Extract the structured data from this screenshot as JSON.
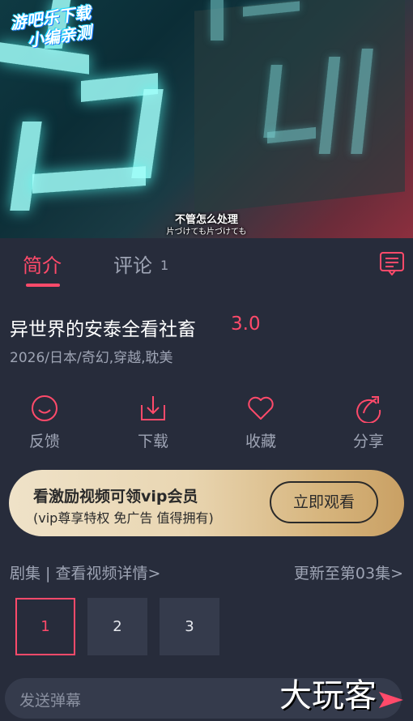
{
  "video": {
    "watermark_line1": "游吧乐下载",
    "watermark_line2": "小编亲测",
    "subtitle_main": "不管怎么处理",
    "subtitle_sub": "片づけても片づけても"
  },
  "tabs": {
    "intro_label": "简介",
    "comment_label": "评论",
    "comment_count": "1"
  },
  "show": {
    "title": "异世界的安泰全看社畜",
    "score": "3.0",
    "meta": "2026/日本/奇幻,穿越,耽美"
  },
  "actions": [
    {
      "label": "反馈",
      "icon": "feedback-smile-icon"
    },
    {
      "label": "下载",
      "icon": "download-icon"
    },
    {
      "label": "收藏",
      "icon": "heart-icon"
    },
    {
      "label": "分享",
      "icon": "share-icon"
    }
  ],
  "vip_banner": {
    "title": "看激励视频可领vip会员",
    "subtitle": "(vip尊享特权 免广告 值得拥有)",
    "button": "立即观看"
  },
  "episodes": {
    "left_label": "剧集 | 查看视频详情>",
    "right_label": "更新至第03集>",
    "items": [
      "1",
      "2",
      "3"
    ],
    "selected": "1"
  },
  "danmaku": {
    "placeholder": "发送弹幕",
    "brand_watermark": "大玩客"
  },
  "colors": {
    "accent": "#ff4a6a",
    "background": "#272c3b",
    "card": "#353b4c",
    "muted_text": "#9ea4b4"
  }
}
